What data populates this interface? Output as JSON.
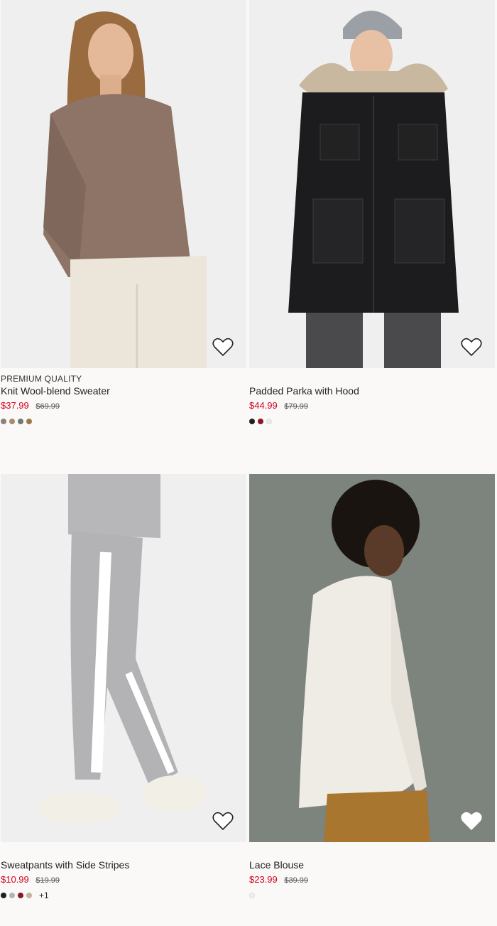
{
  "products": [
    {
      "tag": "PREMIUM QUALITY",
      "title": "Knit Wool-blend Sweater",
      "price": "$37.99",
      "old_price": "$69.99",
      "swatches": [
        "#8e8378",
        "#a88c6e",
        "#6e7a70",
        "#9b7a4c"
      ],
      "more": "",
      "image_bg": "#efefef",
      "favorite": false
    },
    {
      "tag": "",
      "title": "Padded Parka with Hood",
      "price": "$44.99",
      "old_price": "$79.99",
      "swatches": [
        "#1e1f24",
        "#8b1625",
        "#e9e9e9"
      ],
      "more": "",
      "image_bg": "#efefef",
      "favorite": false
    },
    {
      "tag": "",
      "title": "Sweatpants with Side Stripes",
      "price": "$10.99",
      "old_price": "$19.99",
      "swatches": [
        "#1e1f24",
        "#b4b4b4",
        "#8b1625",
        "#c4b29a"
      ],
      "more": "+1",
      "image_bg": "#efefef",
      "favorite": false
    },
    {
      "tag": "",
      "title": "Lace Blouse",
      "price": "$23.99",
      "old_price": "$39.99",
      "swatches": [
        "#eeeeee"
      ],
      "more": "",
      "image_bg": "#7d847e",
      "favorite": false
    }
  ],
  "colors": {
    "sale": "#d6001c",
    "page_bg": "#faf9f8"
  }
}
